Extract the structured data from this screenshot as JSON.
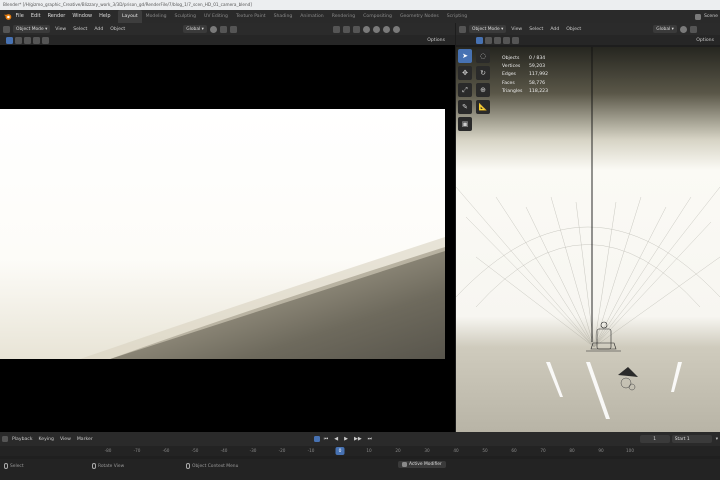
{
  "window": {
    "title": "Blender* [/H/gizmo_graphic_Creative/Blizzary_work_3/3D/prison_gd/RenderFile/7/blog_1/7_scen_HD_01_camera_blend]"
  },
  "menu": [
    "File",
    "Edit",
    "Render",
    "Window",
    "Help"
  ],
  "workspaces": [
    "Layout",
    "Modeling",
    "Sculpting",
    "UV Editing",
    "Texture Paint",
    "Shading",
    "Animation",
    "Rendering",
    "Compositing",
    "Geometry Nodes",
    "Scripting"
  ],
  "active_workspace": "Layout",
  "scene": {
    "name": "Scene"
  },
  "left_viewport": {
    "mode": "Object Mode",
    "menus": [
      "View",
      "Select",
      "Add",
      "Object"
    ],
    "orientation": "Global",
    "options_label": "Options"
  },
  "right_viewport": {
    "mode": "Object Mode",
    "menus": [
      "View",
      "Select",
      "Add",
      "Object"
    ],
    "orientation": "Global",
    "options_label": "Options"
  },
  "stats": [
    {
      "label": "Objects",
      "value": "0 / 834"
    },
    {
      "label": "Vertices",
      "value": "59,203"
    },
    {
      "label": "Edges",
      "value": "117,992"
    },
    {
      "label": "Faces",
      "value": "58,776"
    },
    {
      "label": "Triangles",
      "value": "118,223"
    }
  ],
  "timeline": {
    "menus": [
      "Playback",
      "Keying",
      "View",
      "Marker"
    ],
    "current_frame": "1",
    "start_label": "Start",
    "start_value": "1",
    "ruler": [
      "-80",
      "-70",
      "-60",
      "-50",
      "-40",
      "-30",
      "-20",
      "-10",
      "0",
      "10",
      "20",
      "30",
      "40",
      "50",
      "60",
      "70",
      "80",
      "90",
      "100"
    ],
    "ruler_marker": "0"
  },
  "status": {
    "select": "Select",
    "rotate": "Rotate View",
    "context": "Object Context Menu",
    "active": "Active Modifier"
  },
  "colors": {
    "accent": "#4772b3",
    "header": "#2b2b2b",
    "panel": "#1d1d1d"
  }
}
